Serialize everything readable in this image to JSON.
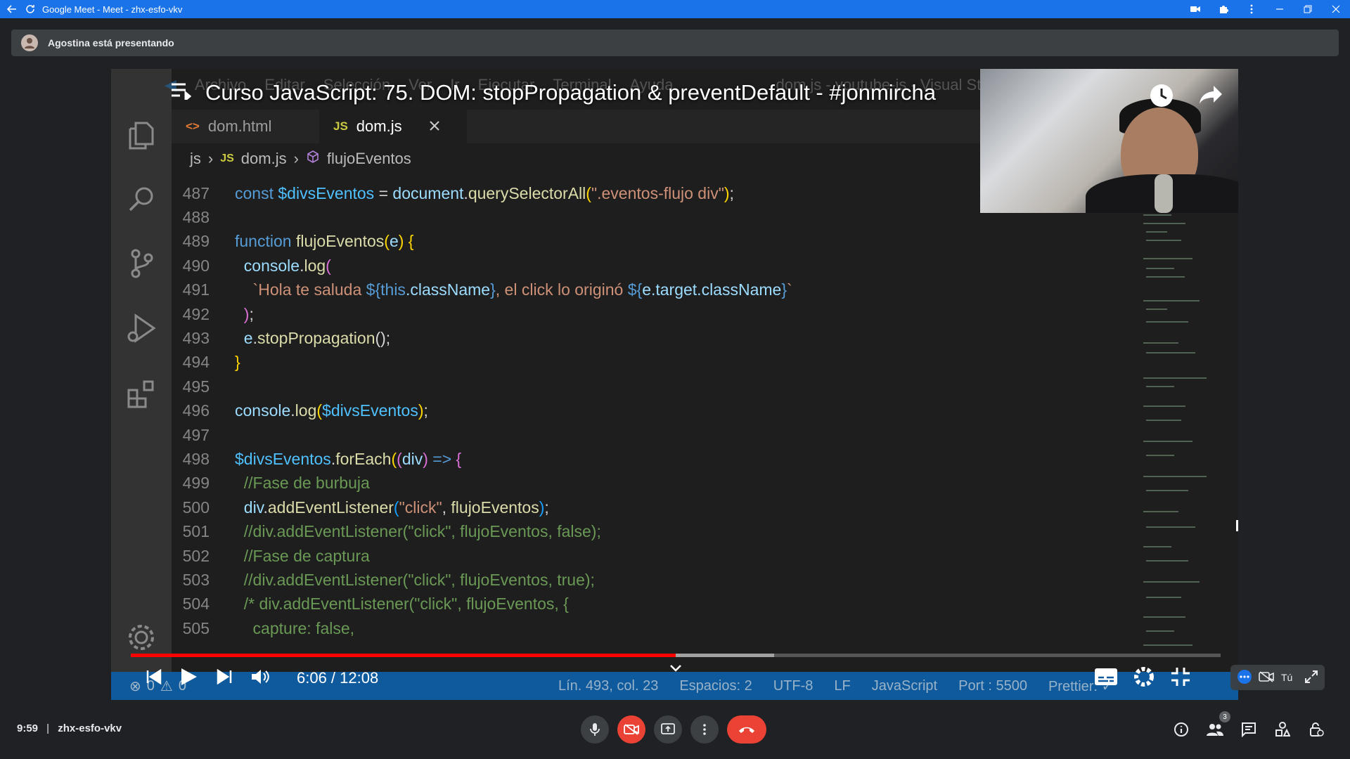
{
  "window": {
    "title": "Google Meet - Meet - zhx-esfo-vkv"
  },
  "banner": {
    "text": "Agostina está presentando"
  },
  "video": {
    "title": "Curso JavaScript: 75. DOM: stopPropagation & preventDefault - #jonmircha",
    "time": "6:06 / 12:08",
    "progress": 0.5,
    "buffered": 0.59
  },
  "editor": {
    "menu": [
      "Archivo",
      "Editar",
      "Selección",
      "Ver",
      "Ir",
      "Ejecutar",
      "Terminal",
      "Ayuda",
      "dom.js - youtube-js - Visual Studio"
    ],
    "tabs": [
      {
        "icon": "<>",
        "label": "dom.html"
      },
      {
        "icon": "JS",
        "label": "dom.js"
      }
    ],
    "breadcrumb": {
      "folder": "js",
      "file_icon": "JS",
      "file": "dom.js",
      "symbol": "flujoEventos"
    },
    "lines": [
      {
        "n": "487",
        "segments": [
          {
            "t": "const ",
            "c": "#569cd6"
          },
          {
            "t": "$divsEventos",
            "c": "#4fc1ff"
          },
          {
            "t": " = ",
            "c": "#d4d4d4"
          },
          {
            "t": "document",
            "c": "#9cdcfe"
          },
          {
            "t": ".",
            "c": "#d4d4d4"
          },
          {
            "t": "querySelectorAll",
            "c": "#dcdcaa"
          },
          {
            "t": "(",
            "c": "#ffd700"
          },
          {
            "t": "\".eventos-flujo div\"",
            "c": "#ce9178"
          },
          {
            "t": ")",
            "c": "#ffd700"
          },
          {
            "t": ";",
            "c": "#d4d4d4"
          }
        ]
      },
      {
        "n": "488",
        "segments": []
      },
      {
        "n": "489",
        "segments": [
          {
            "t": "function ",
            "c": "#569cd6"
          },
          {
            "t": "flujoEventos",
            "c": "#dcdcaa"
          },
          {
            "t": "(",
            "c": "#ffd700"
          },
          {
            "t": "e",
            "c": "#9cdcfe"
          },
          {
            "t": ") ",
            "c": "#ffd700"
          },
          {
            "t": "{",
            "c": "#ffd700"
          }
        ]
      },
      {
        "n": "490",
        "segments": [
          {
            "t": "  console",
            "c": "#9cdcfe"
          },
          {
            "t": ".",
            "c": "#d4d4d4"
          },
          {
            "t": "log",
            "c": "#dcdcaa"
          },
          {
            "t": "(",
            "c": "#da70d6"
          }
        ]
      },
      {
        "n": "491",
        "segments": [
          {
            "t": "    `Hola te saluda ",
            "c": "#ce9178"
          },
          {
            "t": "${",
            "c": "#569cd6"
          },
          {
            "t": "this",
            "c": "#569cd6"
          },
          {
            "t": ".className",
            "c": "#9cdcfe"
          },
          {
            "t": "}",
            "c": "#569cd6"
          },
          {
            "t": ", el click lo originó ",
            "c": "#ce9178"
          },
          {
            "t": "${",
            "c": "#569cd6"
          },
          {
            "t": "e.target.className",
            "c": "#9cdcfe"
          },
          {
            "t": "}",
            "c": "#569cd6"
          },
          {
            "t": "`",
            "c": "#ce9178"
          }
        ]
      },
      {
        "n": "492",
        "segments": [
          {
            "t": "  )",
            "c": "#da70d6"
          },
          {
            "t": ";",
            "c": "#d4d4d4"
          }
        ]
      },
      {
        "n": "493",
        "segments": [
          {
            "t": "  e",
            "c": "#9cdcfe"
          },
          {
            "t": ".",
            "c": "#d4d4d4"
          },
          {
            "t": "stopPropagation",
            "c": "#dcdcaa"
          },
          {
            "t": "();",
            "c": "#d4d4d4"
          }
        ]
      },
      {
        "n": "494",
        "segments": [
          {
            "t": "}",
            "c": "#ffd700"
          }
        ]
      },
      {
        "n": "495",
        "segments": []
      },
      {
        "n": "496",
        "segments": [
          {
            "t": "console",
            "c": "#9cdcfe"
          },
          {
            "t": ".",
            "c": "#d4d4d4"
          },
          {
            "t": "log",
            "c": "#dcdcaa"
          },
          {
            "t": "(",
            "c": "#ffd700"
          },
          {
            "t": "$divsEventos",
            "c": "#4fc1ff"
          },
          {
            "t": ")",
            "c": "#ffd700"
          },
          {
            "t": ";",
            "c": "#d4d4d4"
          }
        ]
      },
      {
        "n": "497",
        "segments": []
      },
      {
        "n": "498",
        "segments": [
          {
            "t": "$divsEventos",
            "c": "#4fc1ff"
          },
          {
            "t": ".",
            "c": "#d4d4d4"
          },
          {
            "t": "forEach",
            "c": "#dcdcaa"
          },
          {
            "t": "(",
            "c": "#ffd700"
          },
          {
            "t": "(",
            "c": "#da70d6"
          },
          {
            "t": "div",
            "c": "#9cdcfe"
          },
          {
            "t": ")",
            "c": "#da70d6"
          },
          {
            "t": " => ",
            "c": "#569cd6"
          },
          {
            "t": "{",
            "c": "#da70d6"
          }
        ]
      },
      {
        "n": "499",
        "segments": [
          {
            "t": "  //Fase de burbuja",
            "c": "#6a9955"
          }
        ]
      },
      {
        "n": "500",
        "segments": [
          {
            "t": "  div",
            "c": "#9cdcfe"
          },
          {
            "t": ".",
            "c": "#d4d4d4"
          },
          {
            "t": "addEventListener",
            "c": "#dcdcaa"
          },
          {
            "t": "(",
            "c": "#179fff"
          },
          {
            "t": "\"click\"",
            "c": "#ce9178"
          },
          {
            "t": ", ",
            "c": "#d4d4d4"
          },
          {
            "t": "flujoEventos",
            "c": "#dcdcaa"
          },
          {
            "t": ")",
            "c": "#179fff"
          },
          {
            "t": ";",
            "c": "#d4d4d4"
          }
        ]
      },
      {
        "n": "501",
        "segments": [
          {
            "t": "  //div.addEventListener(\"click\", flujoEventos, false);",
            "c": "#6a9955"
          }
        ]
      },
      {
        "n": "502",
        "segments": [
          {
            "t": "  //Fase de captura",
            "c": "#6a9955"
          }
        ]
      },
      {
        "n": "503",
        "segments": [
          {
            "t": "  //div.addEventListener(\"click\", flujoEventos, true);",
            "c": "#6a9955"
          }
        ]
      },
      {
        "n": "504",
        "segments": [
          {
            "t": "  /* div.addEventListener(\"click\", flujoEventos, {",
            "c": "#6a9955"
          }
        ]
      },
      {
        "n": "505",
        "segments": [
          {
            "t": "    capture: false,",
            "c": "#6a9955"
          }
        ]
      }
    ],
    "status": {
      "errors": "0",
      "warnings": "0",
      "position": "Lín. 493, col. 23",
      "spaces": "Espacios: 2",
      "encoding": "UTF-8",
      "eol": "LF",
      "language": "JavaScript",
      "port": "Port : 5500",
      "prettier": "Prettier: ✓"
    }
  },
  "pip": {
    "label": "Tú"
  },
  "meeting": {
    "time": "9:59",
    "code": "zhx-esfo-vkv",
    "participants_count": "3"
  },
  "colors": {
    "titlebar": "#1a73e8",
    "statusbar": "#0e5a9c",
    "progress": "#ff0000",
    "end_call": "#ea4335"
  }
}
